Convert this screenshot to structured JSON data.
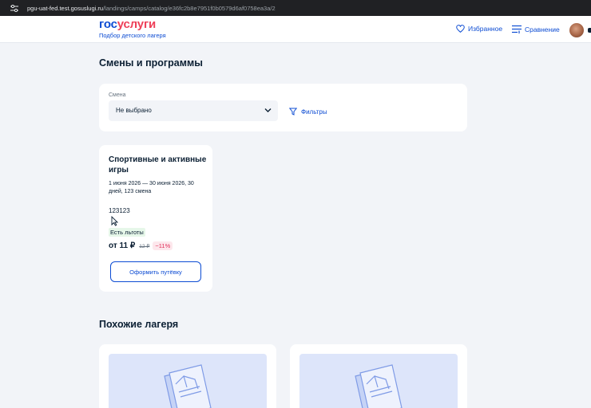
{
  "browser": {
    "url_host": "pgu-uat-fed.test.gosuslugi.ru",
    "url_path": "/landings/camps/catalog/e36fc2b8e7951f0b0579d6af0758ea3a/2"
  },
  "header": {
    "logo_part1": "гос",
    "logo_part2": "услуги",
    "logo_sub": "Подбор детского лагеря",
    "favorites_label": "Избранное",
    "compare_label": "Сравнение"
  },
  "shifts_section": {
    "title": "Смены и программы",
    "filter": {
      "label": "Смена",
      "selected": "Не выбрано",
      "filters_label": "Фильтры"
    },
    "card": {
      "title": "Спортивные и активные игры",
      "dates": "1 июня 2026 — 30 июня 2026, 30 дней, 123 смена",
      "code": "123123",
      "benefit": "Есть льготы",
      "price": "от 11 ₽",
      "old_price": "12 ₽",
      "discount": "−11%",
      "button_label": "Оформить путёвку"
    }
  },
  "similar_section": {
    "title": "Похожие лагеря"
  },
  "colors": {
    "primary": "#0d4cd3",
    "logo_red": "#ee3f58",
    "background": "#f2f4f8",
    "discount": "#e1315b",
    "benefit_bg": "#e6f7e9"
  },
  "icons": [
    "sliders-icon",
    "heart-icon",
    "compare-icon",
    "avatar",
    "chevron-down-icon",
    "filter-icon",
    "cursor-icon",
    "camp-placeholder-icon"
  ]
}
